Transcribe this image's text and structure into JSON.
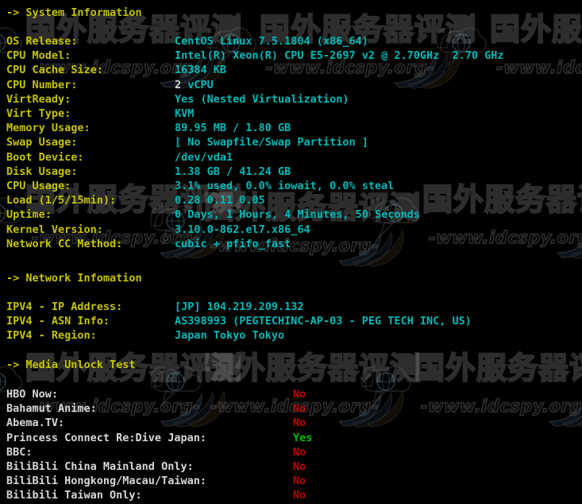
{
  "terminal": {
    "background": "#000000",
    "colors": {
      "header": "#c4c400",
      "label_yellow": "#c4c400",
      "label_white": "#d8d8d8",
      "value_cyan": "#00b9b9",
      "value_white": "#d8d8d8",
      "value_no_red": "#c00000",
      "value_yes_green": "#00c000"
    }
  },
  "watermark": {
    "chinese_text": "国外服务器评测",
    "url_text": "-www.idcspy.org-",
    "logo_icon": "globe-speech-bubble-icon",
    "swoosh_icon": "swoosh-icon"
  },
  "sections": {
    "system": {
      "header": "-> System Information",
      "rows": [
        {
          "label": "OS Release:",
          "value": "CentOS Linux 7.5.1804 (x86_64)"
        },
        {
          "label": "CPU Model:",
          "value": "Intel(R) Xeon(R) CPU E5-2697 v2 @ 2.70GHz  2.70 GHz"
        },
        {
          "label": "CPU Cache Size:",
          "value": "16384 KB"
        },
        {
          "label": "CPU Number:",
          "value": "2",
          "value_suffix": "vCPU"
        },
        {
          "label": "VirtReady:",
          "value": "Yes (Nested Virtualization)"
        },
        {
          "label": "Virt Type:",
          "value": "KVM"
        },
        {
          "label": "Memory Usage:",
          "value": "89.95 MB / 1.80 GB"
        },
        {
          "label": "Swap Usage:",
          "value": "[ No Swapfile/Swap Partition ]"
        },
        {
          "label": "Boot Device:",
          "value": "/dev/vda1"
        },
        {
          "label": "Disk Usage:",
          "value": "1.38 GB / 41.24 GB"
        },
        {
          "label": "CPU Usage:",
          "value": "3.1% used, 0.0% iowait, 0.0% steal"
        },
        {
          "label": "Load (1/5/15min):",
          "value": "0.28 0.11 0.05"
        },
        {
          "label": "Uptime:",
          "value": "0 Days, 1 Hours, 4 Minutes, 50 Seconds"
        },
        {
          "label": "Kernel Version:",
          "value": "3.10.0-862.el7.x86_64"
        },
        {
          "label": "Network CC Method:",
          "value": "cubic + pfifo_fast"
        }
      ]
    },
    "network": {
      "header": "-> Network Infomation",
      "rows": [
        {
          "label": "IPV4 - IP Address:",
          "value": "[JP] 104.219.209.132"
        },
        {
          "label": "IPV4 - ASN Info:",
          "value": "AS398993 (PEGTECHINC-AP-03 - PEG TECH INC, US)"
        },
        {
          "label": "IPV4 - Region:",
          "value": "Japan Tokyo Tokyo"
        }
      ]
    },
    "media": {
      "header": "-> Media Unlock Test",
      "rows": [
        {
          "label": "HBO Now:",
          "value": "No",
          "status": "no"
        },
        {
          "label": "Bahamut Anime:",
          "value": "No",
          "status": "no"
        },
        {
          "label": "Abema.TV:",
          "value": "No",
          "status": "no"
        },
        {
          "label": "Princess Connect Re:Dive Japan:",
          "value": "Yes",
          "status": "yes"
        },
        {
          "label": "BBC:",
          "value": "No",
          "status": "no"
        },
        {
          "label": "BiliBili China Mainland Only:",
          "value": "No",
          "status": "no"
        },
        {
          "label": "BiliBili Hongkong/Macau/Taiwan:",
          "value": "No",
          "status": "no"
        },
        {
          "label": "Bilibili Taiwan Only:",
          "value": "No",
          "status": "no"
        }
      ]
    }
  }
}
